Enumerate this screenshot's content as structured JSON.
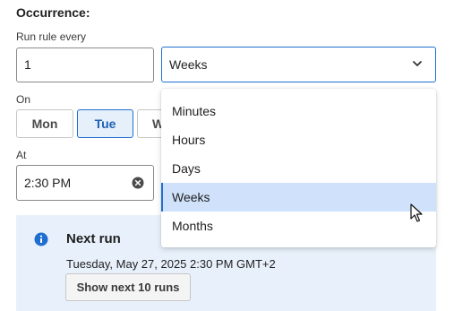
{
  "section_title": "Occurrence:",
  "run_every": {
    "label": "Run rule every",
    "value": "1",
    "unit_selected": "Weeks",
    "unit_options": [
      "Minutes",
      "Hours",
      "Days",
      "Weeks",
      "Months"
    ]
  },
  "on": {
    "label": "On",
    "days": [
      "Mon",
      "Tue",
      "W"
    ],
    "selected_day": "Tue"
  },
  "at": {
    "label": "At",
    "value": "2:30 PM"
  },
  "next_run": {
    "title": "Next run",
    "datetime": "Tuesday, May 27, 2025 2:30 PM GMT+2",
    "button_label": "Show next 10 runs"
  },
  "colors": {
    "accent": "#1f6fd1",
    "selected_bg": "#cfe1fb",
    "info_panel_bg": "#e8f1fb"
  },
  "icons": [
    "chevron-down-icon",
    "clear-icon",
    "info-icon",
    "mouse-cursor-icon"
  ]
}
